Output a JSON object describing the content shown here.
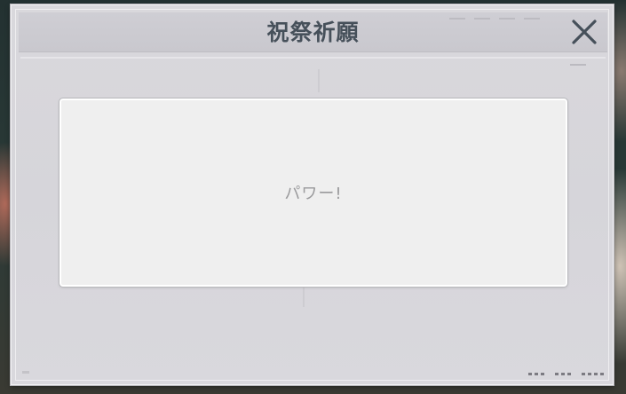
{
  "window": {
    "title": "祝祭祈願"
  },
  "message": {
    "text": "パワー!"
  },
  "icons": {
    "close": "close-icon"
  },
  "colors": {
    "title": "#46505a",
    "panel": "#d9d8dc",
    "message_box": "#efefef",
    "message_text": "#9a9a9c",
    "close_icon": "#46505a"
  }
}
